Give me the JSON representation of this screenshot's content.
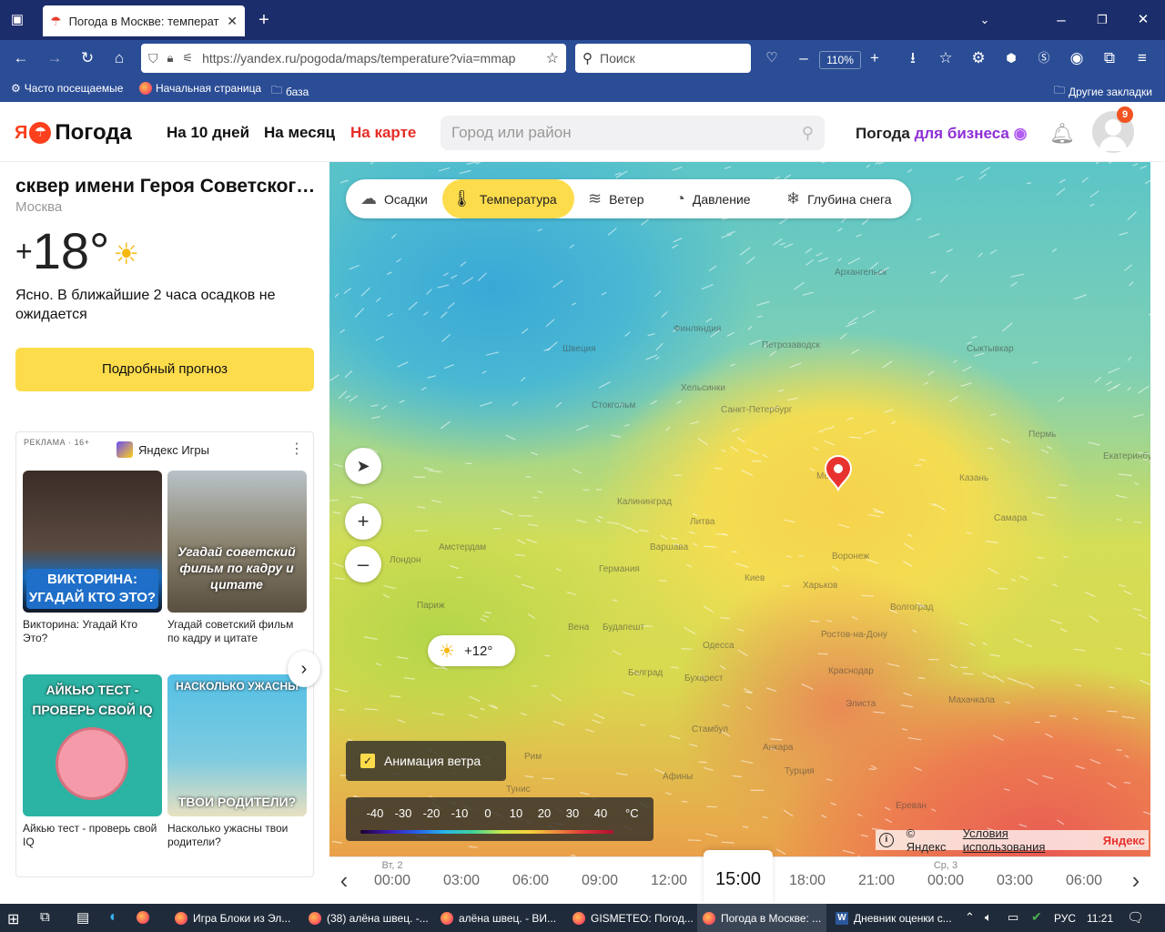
{
  "browser": {
    "tab_title": "Погода в Москве: температура",
    "url": "https://yandex.ru/pogoda/maps/temperature?via=mmap",
    "search_placeholder": "Поиск",
    "zoom": "110%",
    "bookmarks": [
      "Часто посещаемые",
      "Начальная страница",
      "база"
    ],
    "other_bookmarks": "Другие закладки"
  },
  "header": {
    "logo_ya": "Я",
    "logo_text": "Погода",
    "nav": [
      "На 10 дней",
      "На месяц",
      "На карте"
    ],
    "city_placeholder": "Город или район",
    "business_a": "Погода ",
    "business_b": "для бизнеса",
    "notification_count": "9"
  },
  "location": {
    "name": "сквер имени Героя Советског…",
    "city": "Москва",
    "temp_sign": "+",
    "temp": "18°",
    "description": "Ясно. В ближайшие 2 часа осадков не ожидается",
    "detail_button": "Подробный прогноз"
  },
  "ad": {
    "label": "РЕКЛАМА · 16+",
    "source": "Яндекс Игры",
    "cards": [
      {
        "img_text": "ВИКТОРИНА: УГАДАЙ КТО ЭТО?",
        "caption": "Викторина: Угадай Кто Это?"
      },
      {
        "img_text": "Угадай советский фильм по кадру и цитате",
        "caption": "Угадай советский фильм по кадру и цитате"
      },
      {
        "img_text": "АЙКЬЮ ТЕСТ - ПРОВЕРЬ СВОЙ IQ",
        "caption": "Айкью тест - проверь свой IQ"
      },
      {
        "img_text_top": "НАСКОЛЬКО УЖАСНЫ",
        "img_text_bottom": "ТВОИ РОДИТЕЛИ?",
        "caption": "Насколько ужасны твои родители?"
      }
    ]
  },
  "map": {
    "layers": [
      "Осадки",
      "Температура",
      "Ветер",
      "Давление",
      "Глубина снега"
    ],
    "active_layer": "Температура",
    "wind_animation": "Анимация ветра",
    "wind_animation_checked": true,
    "scale": [
      "-40",
      "-30",
      "-20",
      "-10",
      "0",
      "10",
      "20",
      "30",
      "40"
    ],
    "scale_unit": "°C",
    "point_temp": "+12°",
    "copyright": "© Яндекс",
    "terms": "Условия использования",
    "brand": "Яндекс",
    "labels": [
      "Архангельск",
      "Финляндия",
      "Петрозаводск",
      "Сыктывкар",
      "Швеция",
      "Хельсинки",
      "Санкт-Петербург",
      "Стокгольм",
      "Пермь",
      "Москва",
      "Екатеринбург",
      "Калининград",
      "Казань",
      "Литва",
      "Варшава",
      "Германия",
      "Воронеж",
      "Киев",
      "Лондон",
      "Амстердам",
      "Харьков",
      "Самара",
      "Волгоград",
      "Париж",
      "Вена",
      "Будапешт",
      "Ростов-на-Дону",
      "Одесса",
      "Бухарест",
      "Белград",
      "Краснодар",
      "Элиста",
      "Махачкала",
      "Стамбул",
      "Рим",
      "Анкара",
      "Турция",
      "Афины",
      "Тунис",
      "Ереван"
    ]
  },
  "timeline": {
    "slots": [
      {
        "day": "Вт, 2",
        "hour": "00:00"
      },
      {
        "day": "",
        "hour": "03:00"
      },
      {
        "day": "",
        "hour": "06:00"
      },
      {
        "day": "",
        "hour": "09:00"
      },
      {
        "day": "",
        "hour": "12:00"
      },
      {
        "day": "",
        "hour": "15:00"
      },
      {
        "day": "",
        "hour": "18:00"
      },
      {
        "day": "",
        "hour": "21:00"
      },
      {
        "day": "Ср, 3",
        "hour": "00:00"
      },
      {
        "day": "",
        "hour": "03:00"
      },
      {
        "day": "",
        "hour": "06:00"
      }
    ],
    "active_index": 5
  },
  "taskbar": {
    "tasks": [
      "Игра Блоки из Эл...",
      "(38) алёна швец. -...",
      "алёна швец. - ВИ...",
      "GISMETEO: Погод...",
      "Погода в Москве: ...",
      "Дневник оценки с..."
    ],
    "lang": "РУС",
    "time": "11:21"
  }
}
